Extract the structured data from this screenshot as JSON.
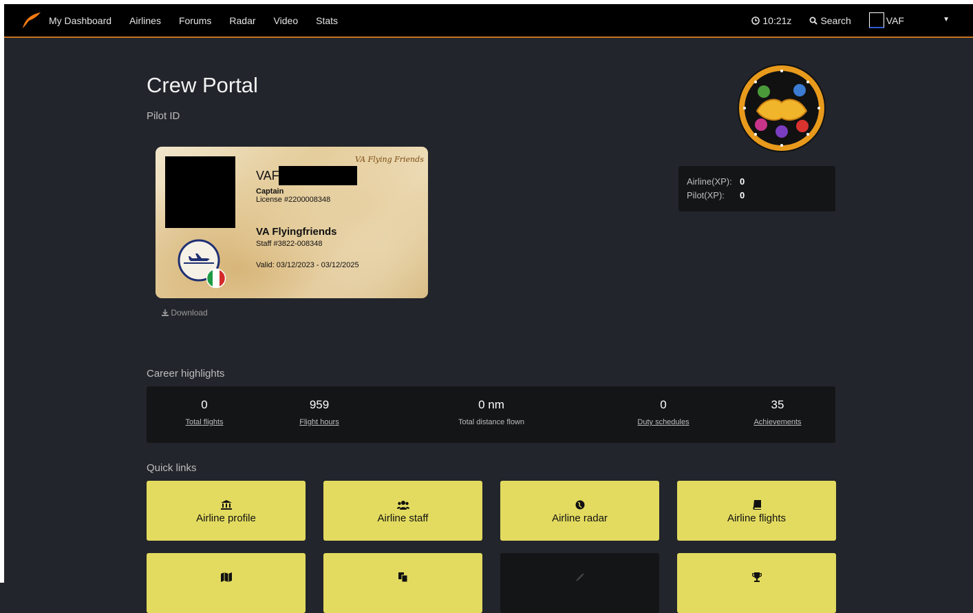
{
  "nav": {
    "items": [
      "My Dashboard",
      "Airlines",
      "Forums",
      "Radar",
      "Video",
      "Stats"
    ],
    "clock": "10:21z",
    "search_label": "Search",
    "user_label": "VAF"
  },
  "page": {
    "title": "Crew Portal",
    "pilot_id_label": "Pilot ID",
    "career_label": "Career highlights",
    "quick_links_label": "Quick links"
  },
  "id_card": {
    "callsign_prefix": "VAF",
    "rank": "Captain",
    "license": "License #2200008348",
    "airline": "VA Flyingfriends",
    "staff": "Staff #3822-008348",
    "valid": "Valid: 03/12/2023 - 03/12/2025",
    "brand": "VA Flying Friends",
    "country_flag": "italy"
  },
  "download_label": "Download",
  "xp": {
    "airline_label": "Airline(XP):",
    "airline_value": "0",
    "pilot_label": "Pilot(XP):",
    "pilot_value": "0"
  },
  "stats": [
    {
      "value": "0",
      "label": "Total flights",
      "link": true
    },
    {
      "value": "959",
      "label": "Flight hours",
      "link": true
    },
    {
      "value": "0 nm",
      "label": "Total distance flown",
      "link": false
    },
    {
      "value": "0",
      "label": "Duty schedules",
      "link": true
    },
    {
      "value": "35",
      "label": "Achievements",
      "link": true
    }
  ],
  "quick_links": [
    {
      "label": "Airline profile",
      "icon": "bank-icon"
    },
    {
      "label": "Airline staff",
      "icon": "users-icon"
    },
    {
      "label": "Airline radar",
      "icon": "globe-icon"
    },
    {
      "label": "Airline flights",
      "icon": "book-icon"
    },
    {
      "label": "",
      "icon": "map-icon"
    },
    {
      "label": "",
      "icon": "copy-icon"
    },
    {
      "label": "",
      "icon": "plane-disabled-icon"
    },
    {
      "label": "",
      "icon": "trophy-icon"
    }
  ],
  "colors": {
    "accent": "#c8741e",
    "tile": "#e3db5f",
    "panel": "#141517",
    "background": "#22252b"
  }
}
